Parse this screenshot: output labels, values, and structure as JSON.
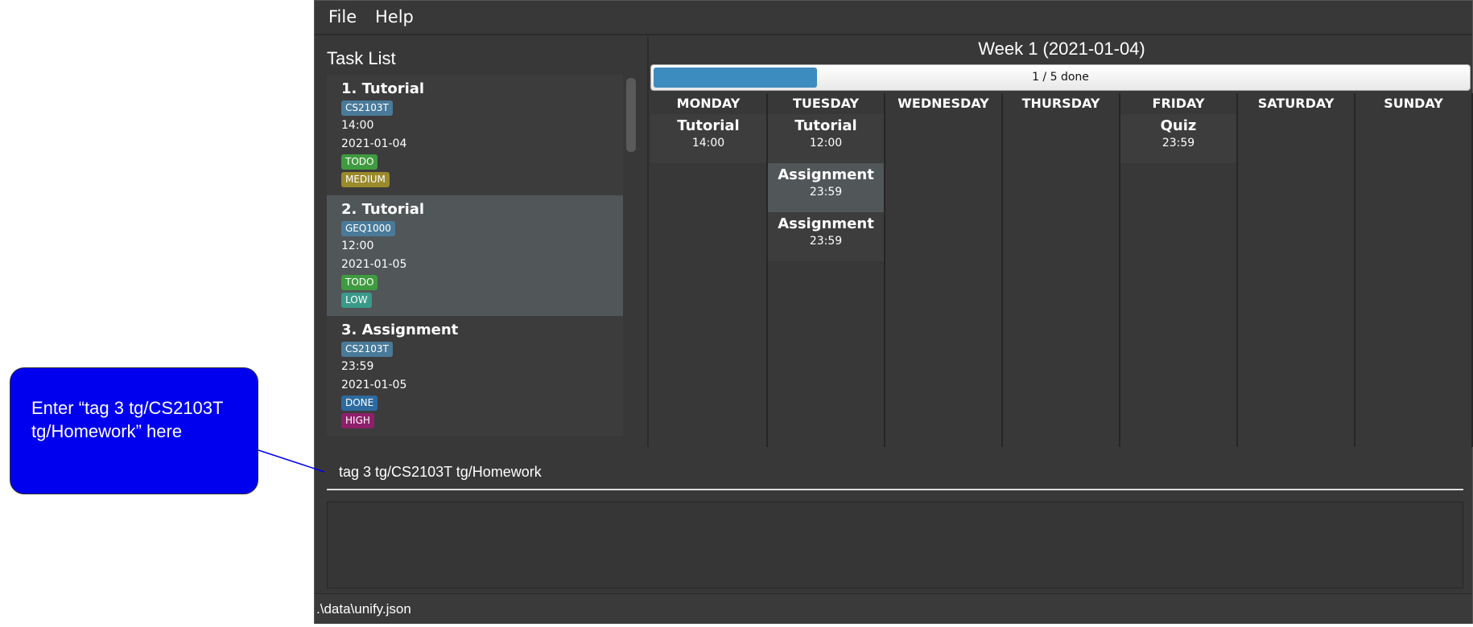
{
  "menu": [
    "File",
    "Help"
  ],
  "task_list": {
    "title": "Task List",
    "tasks": [
      {
        "title": "1.  Tutorial",
        "tag": "CS2103T",
        "time": "14:00",
        "date": "2021-01-04",
        "status": "TODO",
        "priority": "MEDIUM",
        "status_color": "#3f9b3f",
        "priority_color": "#9a8a2a"
      },
      {
        "title": "2.  Tutorial",
        "tag": "GEQ1000",
        "time": "12:00",
        "date": "2021-01-05",
        "status": "TODO",
        "priority": "LOW",
        "status_color": "#3f9b3f",
        "priority_color": "#3a9a8a"
      },
      {
        "title": "3.  Assignment",
        "tag": "CS2103T",
        "time": "23:59",
        "date": "2021-01-05",
        "status": "DONE",
        "priority": "HIGH",
        "status_color": "#2d6aa0",
        "priority_color": "#8e1f6a"
      }
    ]
  },
  "calendar": {
    "week_title": "Week 1 (2021-01-04)",
    "progress_text": "1 / 5 done",
    "progress_fraction": 0.2,
    "days": [
      {
        "name": "MONDAY",
        "entries": [
          {
            "name": "Tutorial",
            "time": "14:00"
          }
        ]
      },
      {
        "name": "TUESDAY",
        "entries": [
          {
            "name": "Tutorial",
            "time": "12:00"
          },
          {
            "name": "Assignment",
            "time": "23:59",
            "selected": true
          },
          {
            "name": "Assignment",
            "time": "23:59"
          }
        ]
      },
      {
        "name": "WEDNESDAY",
        "entries": []
      },
      {
        "name": "THURSDAY",
        "entries": []
      },
      {
        "name": "FRIDAY",
        "entries": [
          {
            "name": "Quiz",
            "time": "23:59"
          }
        ]
      },
      {
        "name": "SATURDAY",
        "entries": []
      },
      {
        "name": "SUNDAY",
        "entries": []
      }
    ]
  },
  "command": {
    "value": "tag 3 tg/CS2103T tg/Homework"
  },
  "result": {
    "text": ""
  },
  "status_bar": {
    "path": ".\\data\\unify.json"
  },
  "callout": {
    "text": "Enter “tag 3 tg/CS2103T tg/Homework” here",
    "color": "#0000ee"
  }
}
